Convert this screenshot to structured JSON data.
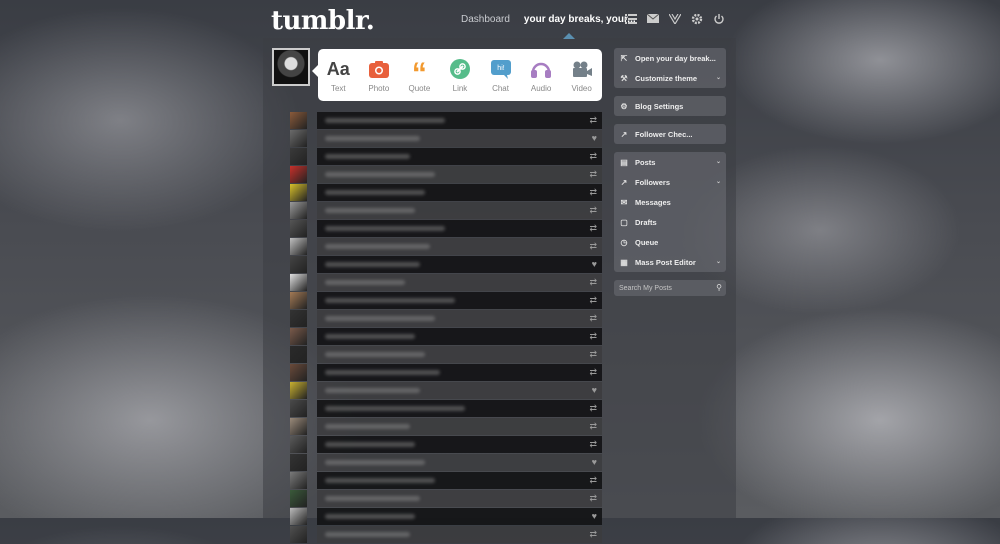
{
  "header": {
    "logo": "tumblr.",
    "nav": [
      {
        "label": "Dashboard",
        "active": false
      },
      {
        "label": "your day breaks, your...",
        "active": true
      }
    ],
    "icons": [
      "list-icon",
      "mail-icon",
      "activity-icon",
      "gear-icon",
      "power-icon"
    ]
  },
  "post_types": [
    {
      "label": "Text",
      "icon": "Aa",
      "color": "#444444"
    },
    {
      "label": "Photo",
      "icon": "photo-icon",
      "color": "#e8603c"
    },
    {
      "label": "Quote",
      "icon": "quote-icon",
      "color": "#f2992e"
    },
    {
      "label": "Link",
      "icon": "link-icon",
      "color": "#56bc8a"
    },
    {
      "label": "Chat",
      "icon": "chat-icon",
      "color": "#529ecc"
    },
    {
      "label": "Audio",
      "icon": "audio-icon",
      "color": "#a77dc2"
    },
    {
      "label": "Video",
      "icon": "video-icon",
      "color": "#748089"
    }
  ],
  "sidebar": {
    "blog_box": [
      {
        "label": "Open your day break...",
        "icon": "external-link-icon"
      },
      {
        "label": "Customize theme",
        "icon": "wrench-icon"
      }
    ],
    "settings": {
      "label": "Blog Settings",
      "icon": "gear-icon"
    },
    "follower_checker": {
      "label": "Follower Chec...",
      "icon": "chart-icon"
    },
    "menu": [
      {
        "label": "Posts",
        "icon": "document-icon"
      },
      {
        "label": "Followers",
        "icon": "chart-icon"
      },
      {
        "label": "Messages",
        "icon": "mail-icon"
      },
      {
        "label": "Drafts",
        "icon": "draft-icon"
      },
      {
        "label": "Queue",
        "icon": "clock-icon"
      },
      {
        "label": "Mass Post Editor",
        "icon": "stack-icon"
      }
    ],
    "search_placeholder": "Search My Posts"
  },
  "feed_rows": [
    {
      "action": "reblog"
    },
    {
      "action": "like"
    },
    {
      "action": "reblog"
    },
    {
      "action": "reblog"
    },
    {
      "action": "reblog"
    },
    {
      "action": "reblog"
    },
    {
      "action": "reblog"
    },
    {
      "action": "reblog"
    },
    {
      "action": "like"
    },
    {
      "action": "reblog"
    },
    {
      "action": "reblog"
    },
    {
      "action": "reblog"
    },
    {
      "action": "reblog"
    },
    {
      "action": "reblog"
    },
    {
      "action": "reblog"
    },
    {
      "action": "like"
    },
    {
      "action": "reblog"
    },
    {
      "action": "reblog"
    },
    {
      "action": "reblog"
    },
    {
      "action": "like"
    },
    {
      "action": "reblog"
    },
    {
      "action": "reblog"
    },
    {
      "action": "like"
    },
    {
      "action": "reblog"
    }
  ],
  "colors": {
    "accent": "#5a8fb0",
    "panel": "#ffffff"
  }
}
